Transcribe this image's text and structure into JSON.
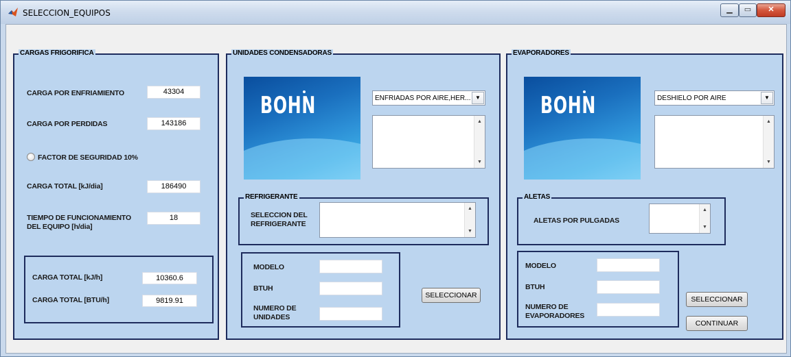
{
  "window": {
    "title": "SELECCION_EQUIPOS"
  },
  "cargas": {
    "title": "CARGAS FRIGORIFICA",
    "enfriamiento_label": "CARGA POR ENFRIAMIENTO",
    "enfriamiento_value": "43304",
    "perdidas_label": "CARGA POR PERDIDAS",
    "perdidas_value": "143186",
    "factor_label": "FACTOR DE SEGURIDAD 10%",
    "total_label": "CARGA TOTAL [kJ/dia]",
    "total_value": "186490",
    "tiempo_label_1": "TIEMPO DE FUNCIONAMIENTO",
    "tiempo_label_2": "DEL EQUIPO [h/dia]",
    "tiempo_value": "18",
    "total_kjh_label": "CARGA TOTAL [kJ/h]",
    "total_kjh_value": "10360.6",
    "total_btu_label": "CARGA TOTAL [BTU/h]",
    "total_btu_value": "9819.91"
  },
  "unidades": {
    "title": "UNIDADES CONDENSADORAS",
    "logo_text": "BOHN",
    "dropdown_value": "ENFRIADAS POR AIRE,HER...",
    "refrigerante_title": "REFRIGERANTE",
    "refrigerante_label_1": "SELECCION DEL",
    "refrigerante_label_2": "REFRIGERANTE",
    "modelo_label": "MODELO",
    "btuh_label": "BTUH",
    "numero_label_1": "NUMERO DE",
    "numero_label_2": "UNIDADES",
    "seleccionar_label": "SELECCIONAR"
  },
  "evaporadores": {
    "title": "EVAPORADORES",
    "logo_text": "BOHN",
    "dropdown_value": "DESHIELO POR AIRE",
    "aletas_title": "ALETAS",
    "aletas_label": "ALETAS POR PULGADAS",
    "modelo_label": "MODELO",
    "btuh_label": "BTUH",
    "numero_label_1": "NUMERO DE",
    "numero_label_2": "EVAPORADORES",
    "seleccionar_label": "SELECCIONAR",
    "continuar_label": "CONTINUAR"
  }
}
